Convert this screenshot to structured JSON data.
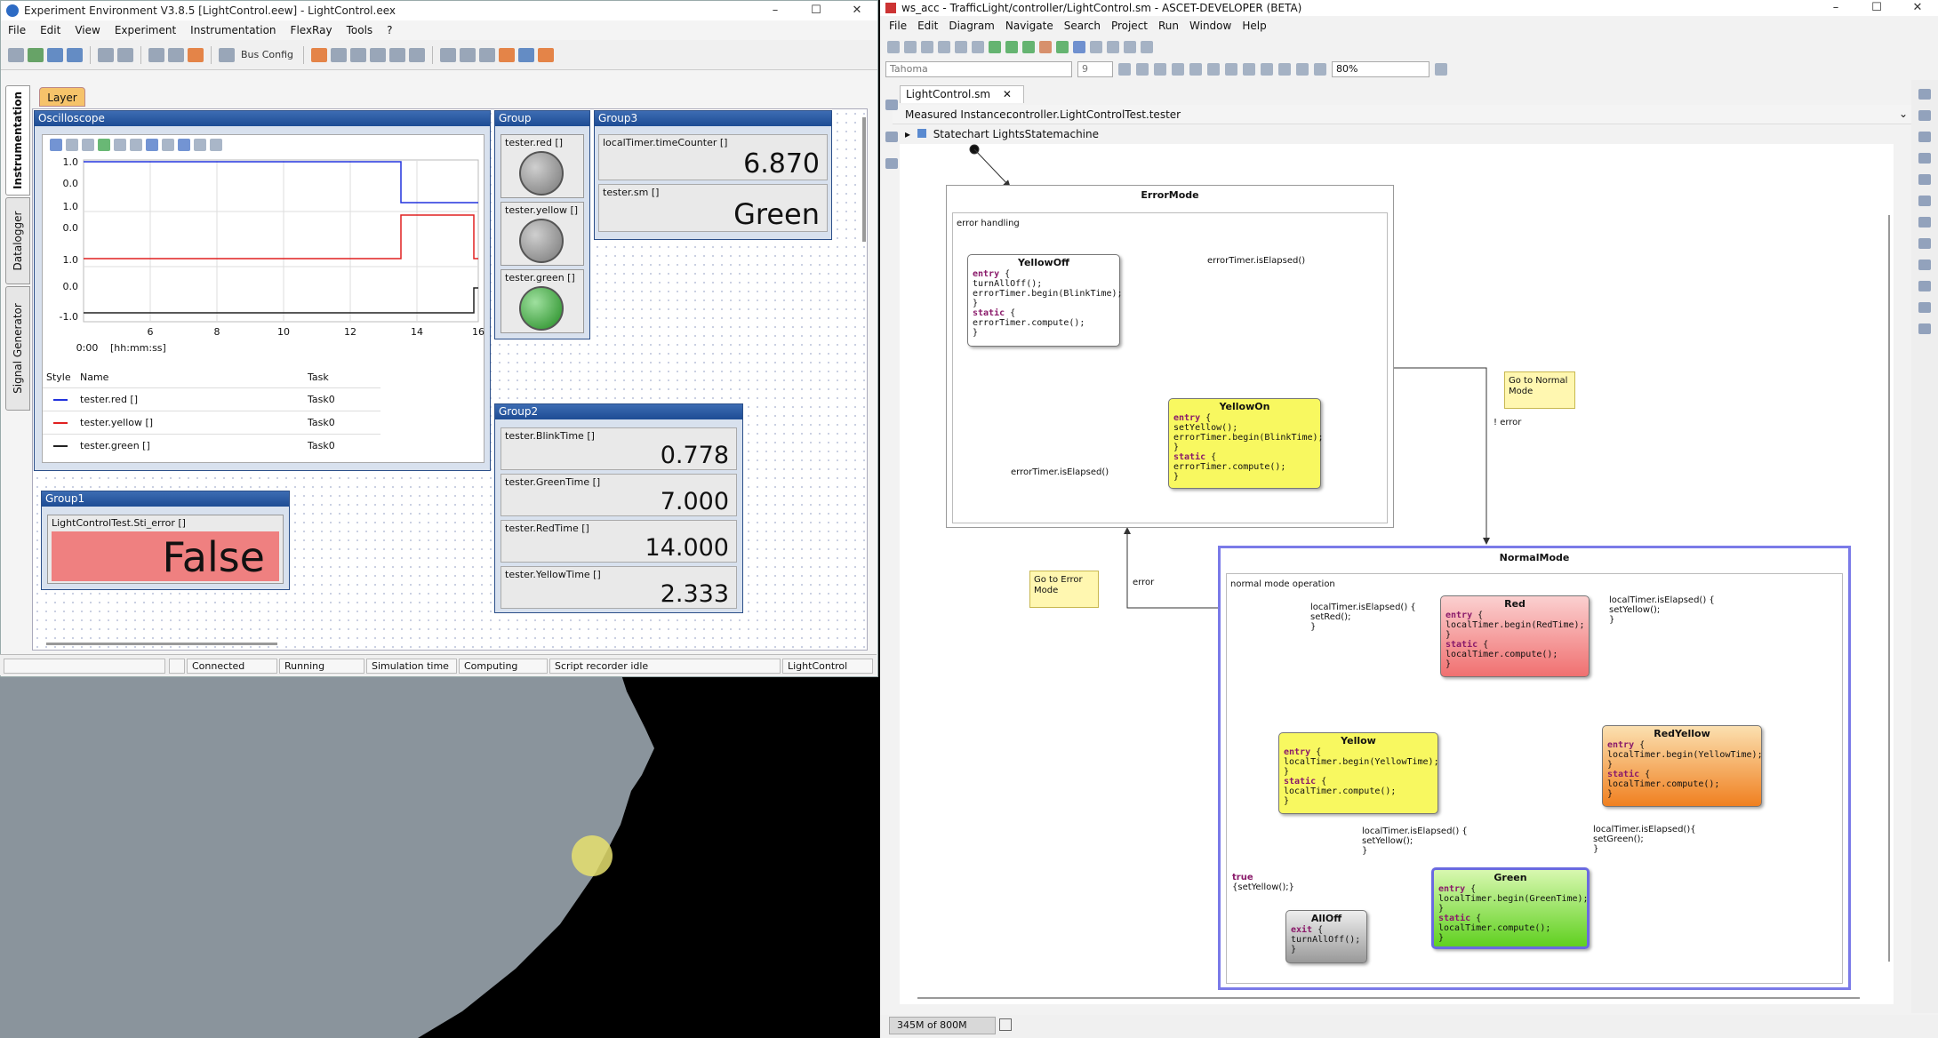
{
  "ee": {
    "title": "Experiment Environment V3.8.5   [LightControl.eew] - LightControl.eex",
    "menu": [
      "File",
      "Edit",
      "View",
      "Experiment",
      "Instrumentation",
      "FlexRay",
      "Tools",
      "?"
    ],
    "bus_config": "Bus Config",
    "vtabs": [
      "Instrumentation",
      "Datalogger",
      "Signal Generator"
    ],
    "layer_tab": "Layer",
    "oscilloscope": {
      "title": "Oscilloscope",
      "y_ticks": [
        "1.0",
        "0.0",
        "1.0",
        "0.0",
        "1.0",
        "0.0",
        "-1.0"
      ],
      "x_ticks": [
        "6",
        "8",
        "10",
        "12",
        "14",
        "16"
      ],
      "x_origin": "0:00",
      "x_unit": "[hh:mm:ss]",
      "table_headers": [
        "Style",
        "Name",
        "Task"
      ],
      "rows": [
        {
          "name": "tester.red []",
          "task": "Task0",
          "color": "#2233dd"
        },
        {
          "name": "tester.yellow []",
          "task": "Task0",
          "color": "#e02020"
        },
        {
          "name": "tester.green []",
          "task": "Task0",
          "color": "#222222"
        }
      ]
    },
    "group": {
      "title": "Group",
      "lamps": [
        {
          "label": "tester.red []",
          "state": "off"
        },
        {
          "label": "tester.yellow []",
          "state": "off"
        },
        {
          "label": "tester.green []",
          "state": "on"
        }
      ]
    },
    "group3": {
      "title": "Group3",
      "items": [
        {
          "label": "localTimer.timeCounter []",
          "value": "6.870"
        },
        {
          "label": "tester.sm []",
          "value": "Green"
        }
      ]
    },
    "group2": {
      "title": "Group2",
      "items": [
        {
          "label": "tester.BlinkTime []",
          "value": "0.778"
        },
        {
          "label": "tester.GreenTime []",
          "value": "7.000"
        },
        {
          "label": "tester.RedTime []",
          "value": "14.000"
        },
        {
          "label": "tester.YellowTime []",
          "value": "2.333"
        }
      ]
    },
    "group1": {
      "title": "Group1",
      "label": "LightControlTest.Sti_error []",
      "value": "False"
    },
    "status": [
      "Connected",
      "Running",
      "Simulation time",
      "Computing",
      "Script recorder idle",
      "LightControl"
    ]
  },
  "ascet": {
    "title": "ws_acc - TrafficLight/controller/LightControl.sm - ASCET-DEVELOPER (BETA)",
    "menu": [
      "File",
      "Edit",
      "Diagram",
      "Navigate",
      "Search",
      "Project",
      "Run",
      "Window",
      "Help"
    ],
    "font_name": "Tahoma",
    "font_size": "9",
    "zoom": "80%",
    "editor_tab": "LightControl.sm",
    "measured_label": "Measured Instance:",
    "measured_value": "controller.LightControlTest.tester",
    "tree_item": "Statechart LightsStatemachine",
    "memory": "345M of 800M",
    "error_mode": {
      "name": "ErrorMode",
      "sub": "error handling"
    },
    "normal_mode": {
      "name": "NormalMode",
      "sub": "normal mode operation"
    },
    "states": {
      "yellowoff": {
        "name": "YellowOff",
        "entry_kw": "entry",
        "l1": "  turnAllOff();",
        "l2": "  errorTimer.begin(BlinkTime);",
        "static_kw": "static",
        "l3": "  errorTimer.compute();"
      },
      "yellowon": {
        "name": "YellowOn",
        "entry_kw": "entry",
        "l1": "  setYellow();",
        "l2": "  errorTimer.begin(BlinkTime);",
        "static_kw": "static",
        "l3": "  errorTimer.compute();"
      },
      "red": {
        "name": "Red",
        "entry_kw": "entry",
        "l1": "  localTimer.begin(RedTime);",
        "static_kw": "static",
        "l2": "  localTimer.compute();"
      },
      "redyellow": {
        "name": "RedYellow",
        "entry_kw": "entry",
        "l1": "  localTimer.begin(YellowTime);",
        "static_kw": "static",
        "l2": "  localTimer.compute();"
      },
      "yellow": {
        "name": "Yellow",
        "entry_kw": "entry",
        "l1": "  localTimer.begin(YellowTime);",
        "static_kw": "static",
        "l2": "  localTimer.compute();"
      },
      "green": {
        "name": "Green",
        "entry_kw": "entry",
        "l1": "  localTimer.begin(GreenTime);",
        "static_kw": "static",
        "l2": "  localTimer.compute();"
      },
      "alloff": {
        "name": "AllOff",
        "exit_kw": "exit",
        "l1": "  turnAllOff();"
      }
    },
    "transitions": {
      "t1": "errorTimer.isElapsed()",
      "t2": "errorTimer.isElapsed()",
      "t3": "! error",
      "t4": "error",
      "t5a": "localTimer.isElapsed() {",
      "t5b": "  setRed();",
      "t6a": "localTimer.isElapsed() {",
      "t6b": "  setYellow();",
      "t7a": "localTimer.isElapsed(){",
      "t7b": "  setGreen();",
      "t8a": "localTimer.isElapsed() {",
      "t8b": "  setYellow();",
      "t9a": "true",
      "t9b": "{setYellow();}"
    },
    "notes": {
      "n1": "Go to Normal Mode",
      "n2": "Go to Error Mode"
    }
  }
}
